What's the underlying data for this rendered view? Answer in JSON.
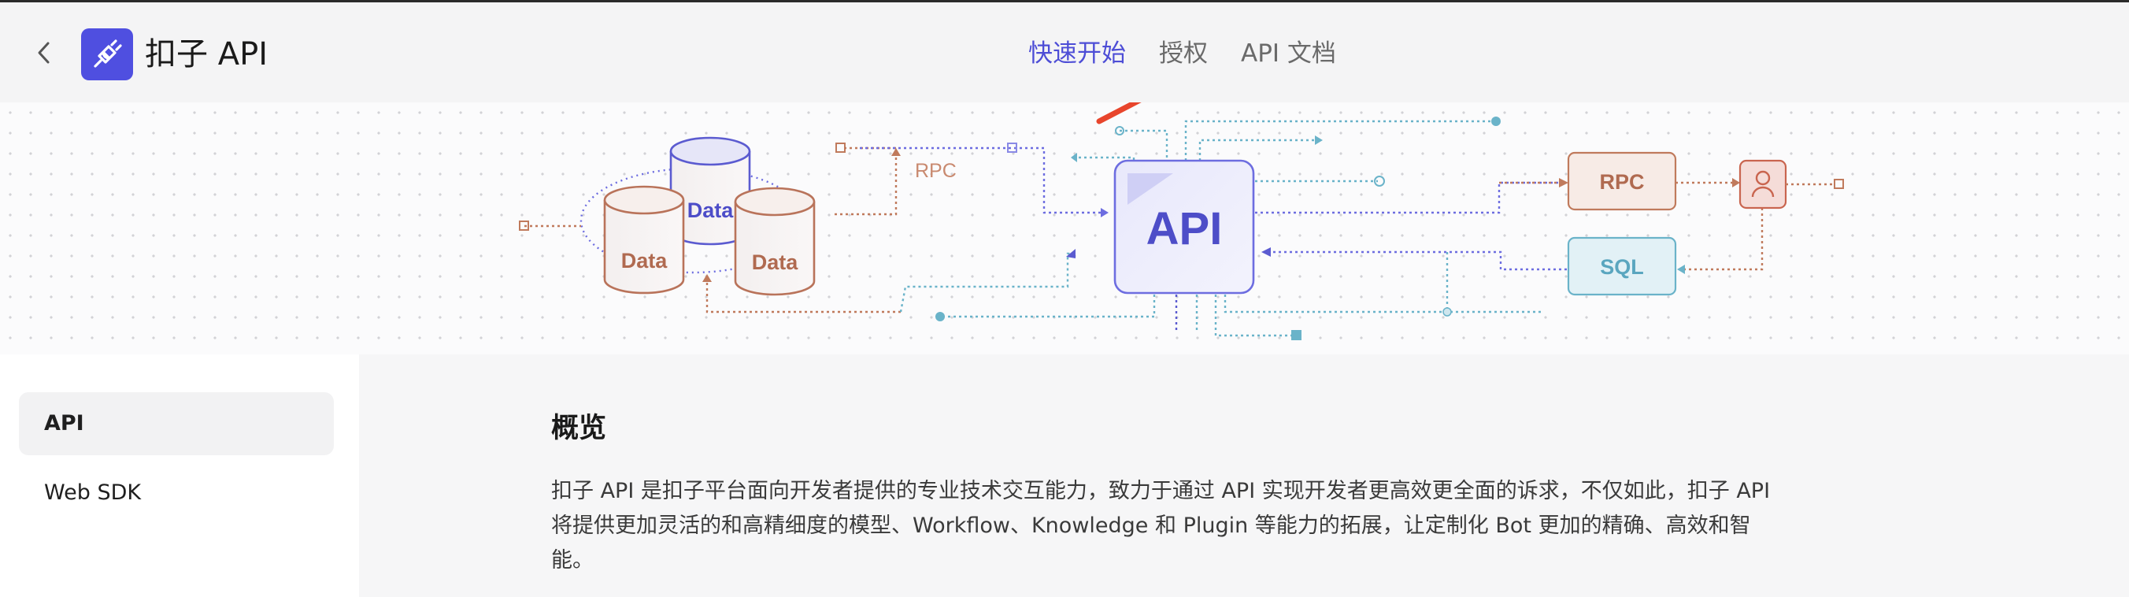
{
  "header": {
    "back_label": "返回",
    "app_title": "扣子 API",
    "tabs": [
      {
        "label": "快速开始",
        "active": true
      },
      {
        "label": "授权",
        "active": false
      },
      {
        "label": "API 文档",
        "active": false
      }
    ]
  },
  "hero": {
    "data_labels": [
      "Data",
      "Data",
      "Data"
    ],
    "rpc_link_label": "RPC",
    "api_label": "API",
    "rpc_box_label": "RPC",
    "sql_box_label": "SQL"
  },
  "sidebar": {
    "items": [
      {
        "label": "API",
        "active": true
      },
      {
        "label": "Web SDK",
        "active": false
      }
    ]
  },
  "main": {
    "title": "概览",
    "paragraph": "扣子 API 是扣子平台面向开发者提供的专业技术交互能力，致力于通过 API 实现开发者更高效更全面的诉求，不仅如此，扣子 API 将提供更加灵活的和高精细度的模型、Workflow、Knowledge 和 Plugin 等能力的拓展，让定制化 Bot 更加的精确、高效和智能。"
  },
  "colors": {
    "accent": "#4d4dd6",
    "logo_bg": "#4f4fe0",
    "arrow": "#e8452c",
    "rpc": "#c07a5c",
    "sql": "#6ab3c9",
    "data_blue": "#5b5bd0"
  },
  "icons": [
    "chevron-left-icon",
    "plug-icon",
    "user-icon"
  ]
}
